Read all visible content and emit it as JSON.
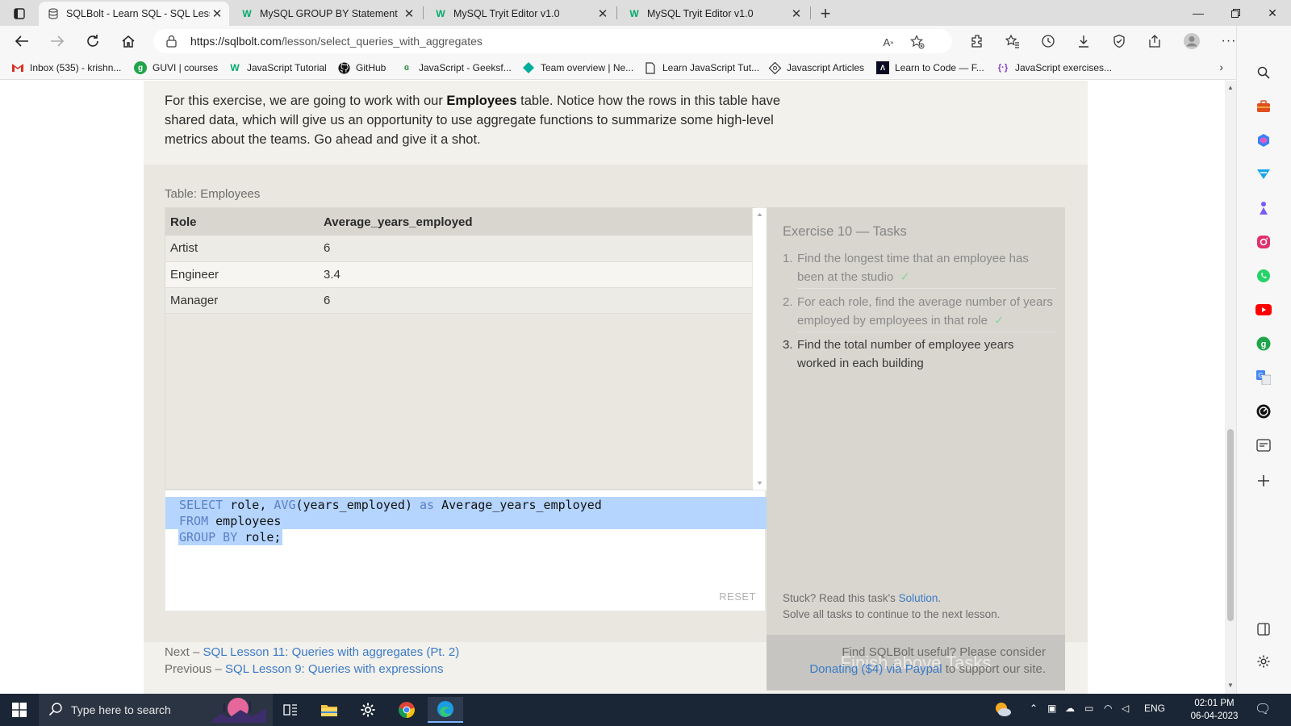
{
  "browser": {
    "tabs": [
      {
        "title": "SQLBolt - Learn SQL - SQL Lesson",
        "favicon": "database-icon",
        "active": true
      },
      {
        "title": "MySQL GROUP BY Statement",
        "favicon": "w3schools-icon",
        "active": false
      },
      {
        "title": "MySQL Tryit Editor v1.0",
        "favicon": "w3schools-icon",
        "active": false
      },
      {
        "title": "MySQL Tryit Editor v1.0",
        "favicon": "w3schools-icon",
        "active": false
      }
    ],
    "url": {
      "host": "https://sqlbolt.com",
      "path": "/lesson/select_queries_with_aggregates"
    },
    "favorites": [
      {
        "label": "Inbox (535) - krishn...",
        "icon": "gmail-icon"
      },
      {
        "label": "GUVI | courses",
        "icon": "guvi-icon"
      },
      {
        "label": "JavaScript Tutorial",
        "icon": "w3schools-icon"
      },
      {
        "label": "GitHub",
        "icon": "github-icon"
      },
      {
        "label": "JavaScript - Geeksf...",
        "icon": "geeksforgeeks-icon"
      },
      {
        "label": "Team overview | Ne...",
        "icon": "diamond-icon"
      },
      {
        "label": "Learn JavaScript Tut...",
        "icon": "page-icon"
      },
      {
        "label": "Javascript Articles",
        "icon": "gear-diamond-icon"
      },
      {
        "label": "Learn to Code — F...",
        "icon": "freecodecamp-icon"
      },
      {
        "label": "JavaScript exercises...",
        "icon": "braces-icon"
      }
    ]
  },
  "lesson": {
    "intro_before": "For this exercise, we are going to work with our ",
    "intro_bold": "Employees",
    "intro_after": " table. Notice how the rows in this table have shared data, which will give us an opportunity to use aggregate functions to summarize some high-level metrics about the teams. Go ahead and give it a shot.",
    "table_label": "Table: Employees",
    "table": {
      "headers": [
        "Role",
        "Average_years_employed"
      ],
      "rows": [
        [
          "Artist",
          "6"
        ],
        [
          "Engineer",
          "3.4"
        ],
        [
          "Manager",
          "6"
        ]
      ]
    },
    "editor": {
      "line1_kw1": "SELECT",
      "line1_mid": " role, ",
      "line1_kw2": "AVG",
      "line1_mid2": "(years_employed) ",
      "line1_kw3": "as",
      "line1_end": " Average_years_employed",
      "line2_kw": "FROM",
      "line2_rest": " employees",
      "line3_kw": "GROUP BY",
      "line3_rest": " role;",
      "reset_label": "RESET"
    },
    "tasks": {
      "title": "Exercise 10 — Tasks",
      "items": [
        {
          "num": "1.",
          "text": "Find the longest time that an employee has been at the studio",
          "done": true,
          "check": "✓"
        },
        {
          "num": "2.",
          "text": "For each role, find the average number of years employed by employees in that role",
          "done": true,
          "check": "✓"
        },
        {
          "num": "3.",
          "text": "Find the total number of employee years worked in each building",
          "done": false,
          "check": ""
        }
      ],
      "stuck_prefix": "Stuck? Read this task's ",
      "stuck_link": "Solution",
      "stuck_suffix": ".",
      "continue_note": "Solve all tasks to continue to the next lesson.",
      "finish_label": "Finish above Tasks"
    },
    "footer": {
      "next_prefix": "Next – ",
      "next_link": "SQL Lesson 11: Queries with aggregates (Pt. 2)",
      "prev_prefix": "Previous – ",
      "prev_link": "SQL Lesson 9: Queries with expressions",
      "donate_line1": "Find SQLBolt useful? Please consider",
      "donate_link": "Donating ($4) via Paypal",
      "donate_suffix": " to support our site."
    }
  },
  "taskbar": {
    "search_placeholder": "Type here to search",
    "language": "ENG",
    "time": "02:01 PM",
    "date": "06-04-2023"
  },
  "colors": {
    "link": "#3a7ac7",
    "check": "#8ed39b",
    "selection": "#b5d5ff",
    "taskbar": "#1a2535"
  }
}
